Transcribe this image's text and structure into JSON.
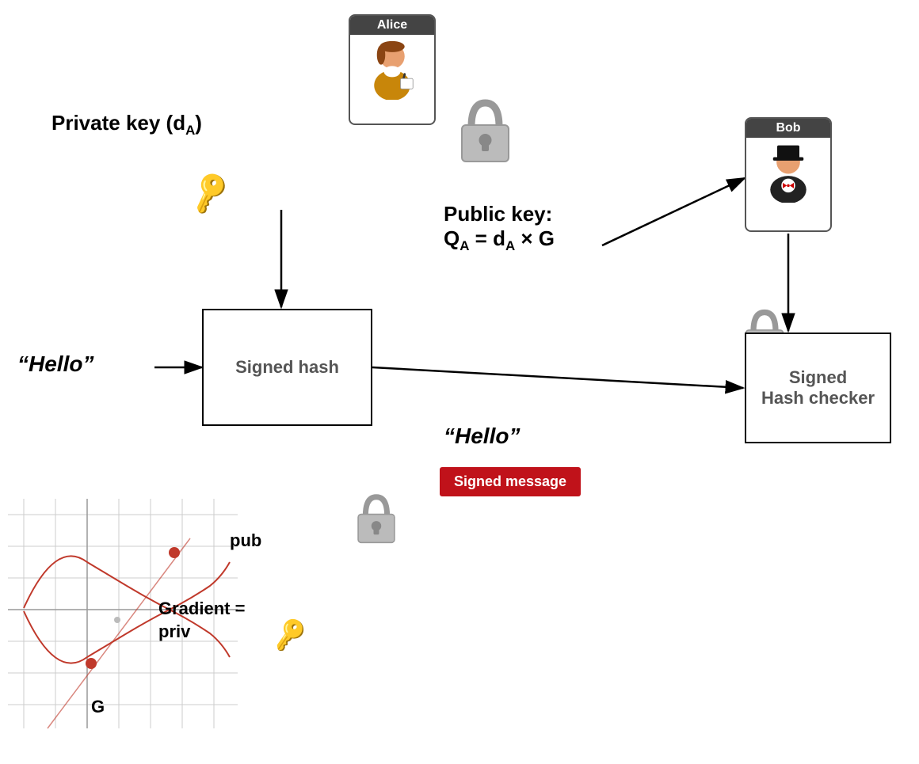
{
  "alice": {
    "name": "Alice",
    "header_bg": "#444"
  },
  "bob": {
    "name": "Bob",
    "header_bg": "#444"
  },
  "labels": {
    "private_key": "Private key (d",
    "private_key_sub": "A",
    "private_key_end": ")",
    "public_key_line1": "Public key:",
    "public_key_line2": "Q",
    "public_key_sub": "A",
    "public_key_eq": " = d",
    "public_key_sub2": "A",
    "public_key_end": " × G",
    "signed_hash": "Signed hash",
    "signed_hash_checker": "Signed\nHash checker",
    "hello_input": "“Hello”",
    "hello_output": "“Hello”",
    "signed_message": "Signed message",
    "gradient_line1": "Gradient =",
    "gradient_line2": "priv",
    "g_label": "G",
    "pub_label": "pub"
  },
  "colors": {
    "arrow": "#000000",
    "badge_bg": "#c0121a",
    "badge_text": "#ffffff",
    "box_border": "#000000",
    "key_color": "#888888",
    "padlock_color": "#aaaaaa",
    "alice_header": "#444444",
    "bob_header": "#444444",
    "curve_color": "#c0392b",
    "grid_color": "#cccccc",
    "dot_color": "#c0392b"
  }
}
